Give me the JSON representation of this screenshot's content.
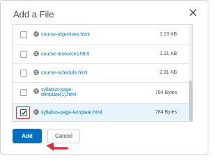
{
  "dialog": {
    "title": "Add a File",
    "close_icon": "close-icon"
  },
  "files": [
    {
      "name": "course-objectives.html",
      "size": "1.19 KB",
      "checked": false
    },
    {
      "name": "course-resources.html",
      "size": "1.21 KB",
      "checked": false
    },
    {
      "name": "course-schedule.html",
      "size": "2.31 KB",
      "checked": false
    },
    {
      "name": "syllabus-page-template(1).html",
      "name_line1": "syllabus-page-",
      "name_line2": "template(1).html",
      "size": "784 Bytes",
      "checked": false
    },
    {
      "name": "syllabus-page-template.html",
      "size": "784 Bytes",
      "checked": true
    }
  ],
  "buttons": {
    "add_label": "Add",
    "cancel_label": "Cancel"
  },
  "colors": {
    "primary": "#006fbf",
    "highlight": "#d6353b",
    "selected_row": "#e8f4fb"
  },
  "icons": {
    "file": "globe-icon",
    "checkmark": "checkmark-icon",
    "arrow": "pointer-arrow-icon"
  }
}
